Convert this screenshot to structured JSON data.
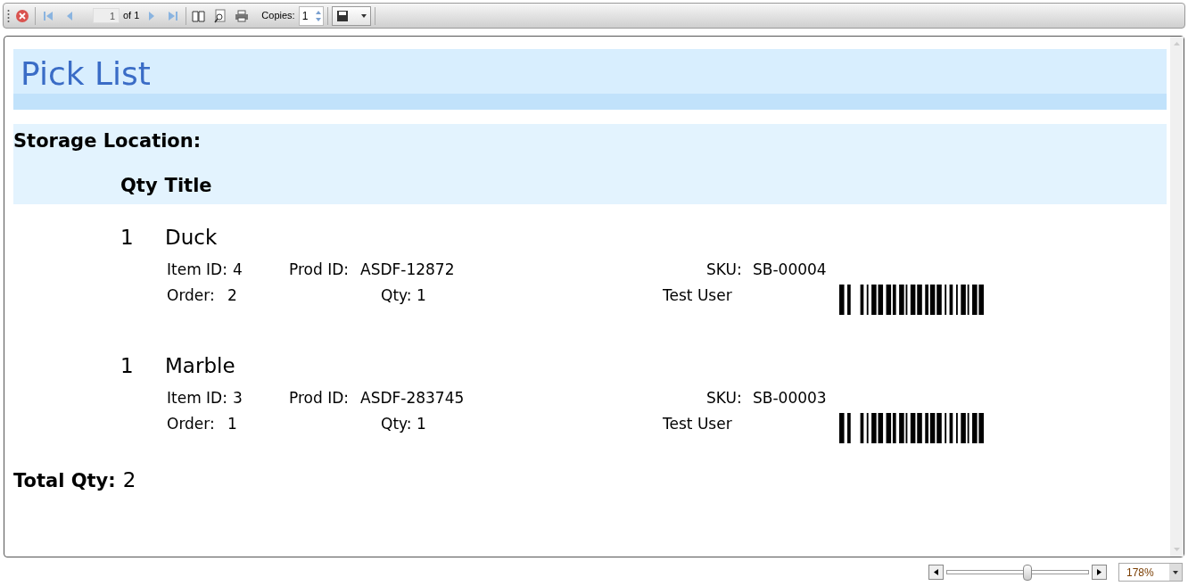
{
  "toolbar": {
    "page_value": "1",
    "page_of": "of 1",
    "copies_label": "Copies:",
    "copies_value": "1"
  },
  "report": {
    "title": "Pick List",
    "group_label": "Storage Location:",
    "columns": [
      "Qty",
      "Title"
    ],
    "items": [
      {
        "qty": "1",
        "title": "Duck",
        "item_id_label": "Item ID:",
        "item_id": "4",
        "prod_id_label": "Prod ID:",
        "prod_id": "ASDF-12872",
        "sku_label": "SKU:",
        "sku": "SB-00004",
        "order_label": "Order:",
        "order": "2",
        "line_qty_label": "Qty:",
        "line_qty": "1",
        "user": "Test User"
      },
      {
        "qty": "1",
        "title": "Marble",
        "item_id_label": "Item ID:",
        "item_id": "3",
        "prod_id_label": "Prod ID:",
        "prod_id": "ASDF-283745",
        "sku_label": "SKU:",
        "sku": "SB-00003",
        "order_label": "Order:",
        "order": "1",
        "line_qty_label": "Qty:",
        "line_qty": "1",
        "user": "Test User"
      }
    ],
    "total_label": "Total Qty:",
    "total": "2"
  },
  "zoom": {
    "level": 0.57,
    "value": "178%"
  }
}
